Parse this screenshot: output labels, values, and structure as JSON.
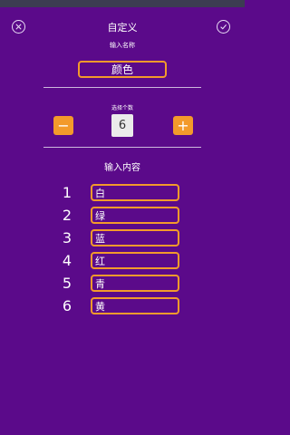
{
  "header": {
    "title": "自定义",
    "close_icon": "close-circle-icon",
    "confirm_icon": "check-circle-icon"
  },
  "name_section": {
    "label": "输入名称",
    "value": "颜色"
  },
  "count_section": {
    "label": "选择个数",
    "minus_label": "−",
    "plus_label": "+",
    "count": "6"
  },
  "content_section": {
    "label": "输入内容",
    "items": [
      {
        "number": "1",
        "value": "白"
      },
      {
        "number": "2",
        "value": "绿"
      },
      {
        "number": "3",
        "value": "蓝"
      },
      {
        "number": "4",
        "value": "红"
      },
      {
        "number": "5",
        "value": "青"
      },
      {
        "number": "6",
        "value": "黄"
      }
    ]
  },
  "colors": {
    "background": "#5b0a8a",
    "accent": "#f39a2b",
    "count_box": "#ebebeb"
  }
}
